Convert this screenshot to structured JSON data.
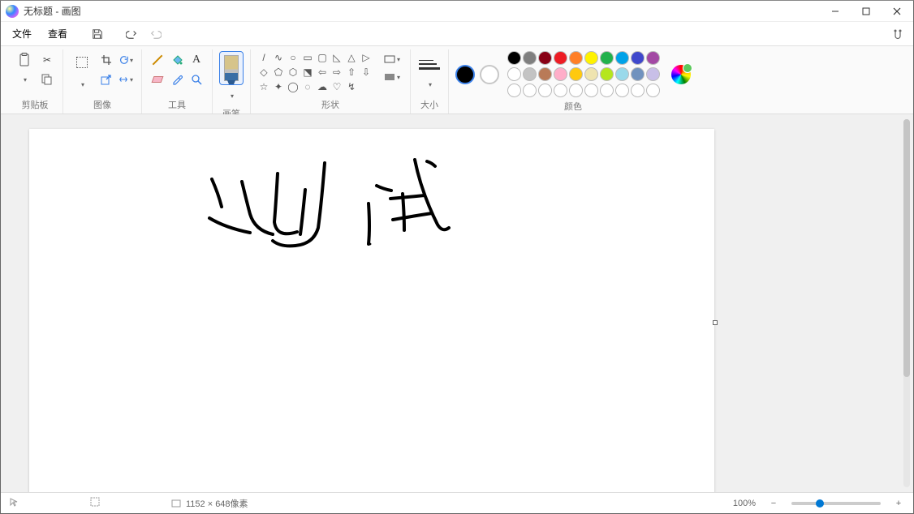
{
  "titlebar": {
    "title": "无标题 - 画图"
  },
  "menu": {
    "file": "文件",
    "view": "查看"
  },
  "ribbon": {
    "clipboard": {
      "label": "剪贴板"
    },
    "image": {
      "label": "图像"
    },
    "tools": {
      "label": "工具"
    },
    "brush": {
      "label": "画笔"
    },
    "shapes": {
      "label": "形状",
      "items": [
        "/",
        "∿",
        "○",
        "▭",
        "▢",
        "◺",
        "△",
        "▷",
        "◇",
        "⬠",
        "⬡",
        "⬔",
        "⇦",
        "⇨",
        "⇧",
        "⇩",
        "☆",
        "✦",
        "◯",
        "◌",
        "☁",
        "♡",
        "↯",
        ""
      ]
    },
    "size": {
      "label": "大小"
    },
    "colors": {
      "label": "颜色",
      "current1": "#000000",
      "current2": "#ffffff",
      "palette_row1": [
        "#000000",
        "#7f7f7f",
        "#880015",
        "#ed1c24",
        "#ff7f27",
        "#fff200",
        "#22b14c",
        "#00a2e8",
        "#3f48cc",
        "#a349a4"
      ],
      "palette_row2": [
        "#ffffff",
        "#c3c3c3",
        "#b97a57",
        "#ffaec9",
        "#ffc90e",
        "#efe4b0",
        "#b5e61d",
        "#99d9ea",
        "#7092be",
        "#c8bfe7"
      ]
    }
  },
  "status": {
    "canvas_size": "1152 × 648像素",
    "zoom_percent": "100%"
  }
}
